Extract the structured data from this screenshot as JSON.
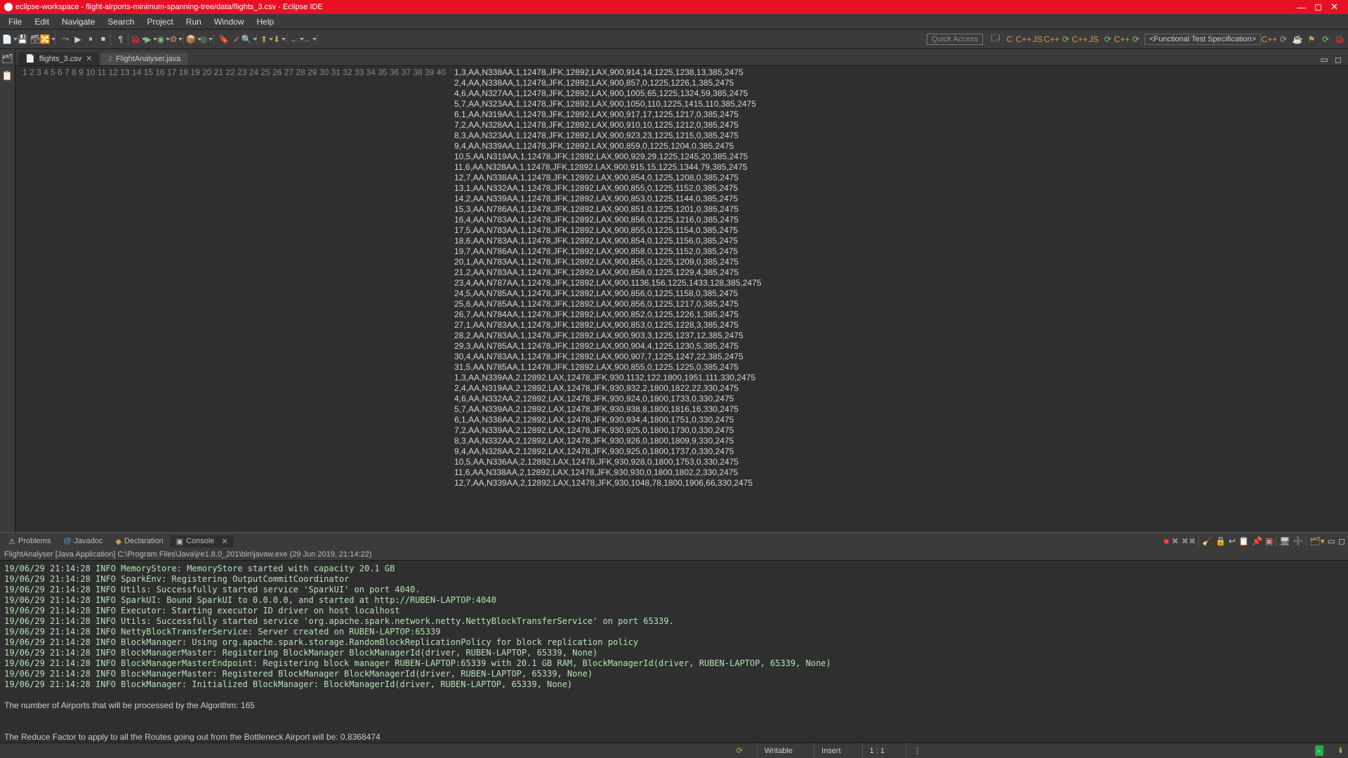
{
  "window_title": "eclipse-workspace - flight-airports-minimum-spanning-tree/data/flights_3.csv - Eclipse IDE",
  "menus": [
    "File",
    "Edit",
    "Navigate",
    "Search",
    "Project",
    "Run",
    "Window",
    "Help"
  ],
  "quick_access": "Quick Access",
  "perspective": "<Functional Test Specification>",
  "editor_tabs": [
    {
      "label": "flights_3.csv",
      "active": true
    },
    {
      "label": "FlightAnalyser.java",
      "active": false
    }
  ],
  "code_lines": [
    "1,3,AA,N338AA,1,12478,JFK,12892,LAX,900,914,14,1225,1238,13,385,2475",
    "2,4,AA,N338AA,1,12478,JFK,12892,LAX,900,857,0,1225,1226,1,385,2475",
    "4,6,AA,N327AA,1,12478,JFK,12892,LAX,900,1005,65,1225,1324,59,385,2475",
    "5,7,AA,N323AA,1,12478,JFK,12892,LAX,900,1050,110,1225,1415,110,385,2475",
    "6,1,AA,N319AA,1,12478,JFK,12892,LAX,900,917,17,1225,1217,0,385,2475",
    "7,2,AA,N328AA,1,12478,JFK,12892,LAX,900,910,10,1225,1212,0,385,2475",
    "8,3,AA,N323AA,1,12478,JFK,12892,LAX,900,923,23,1225,1215,0,385,2475",
    "9,4,AA,N339AA,1,12478,JFK,12892,LAX,900,859,0,1225,1204,0,385,2475",
    "10,5,AA,N319AA,1,12478,JFK,12892,LAX,900,929,29,1225,1245,20,385,2475",
    "11,6,AA,N328AA,1,12478,JFK,12892,LAX,900,915,15,1225,1344,79,385,2475",
    "12,7,AA,N338AA,1,12478,JFK,12892,LAX,900,854,0,1225,1208,0,385,2475",
    "13,1,AA,N332AA,1,12478,JFK,12892,LAX,900,855,0,1225,1152,0,385,2475",
    "14,2,AA,N339AA,1,12478,JFK,12892,LAX,900,853,0,1225,1144,0,385,2475",
    "15,3,AA,N786AA,1,12478,JFK,12892,LAX,900,851,0,1225,1201,0,385,2475",
    "16,4,AA,N783AA,1,12478,JFK,12892,LAX,900,856,0,1225,1216,0,385,2475",
    "17,5,AA,N783AA,1,12478,JFK,12892,LAX,900,855,0,1225,1154,0,385,2475",
    "18,6,AA,N783AA,1,12478,JFK,12892,LAX,900,854,0,1225,1156,0,385,2475",
    "19,7,AA,N786AA,1,12478,JFK,12892,LAX,900,858,0,1225,1152,0,385,2475",
    "20,1,AA,N783AA,1,12478,JFK,12892,LAX,900,855,0,1225,1209,0,385,2475",
    "21,2,AA,N783AA,1,12478,JFK,12892,LAX,900,858,0,1225,1229,4,385,2475",
    "23,4,AA,N787AA,1,12478,JFK,12892,LAX,900,1136,156,1225,1433,128,385,2475",
    "24,5,AA,N785AA,1,12478,JFK,12892,LAX,900,856,0,1225,1158,0,385,2475",
    "25,6,AA,N785AA,1,12478,JFK,12892,LAX,900,856,0,1225,1217,0,385,2475",
    "26,7,AA,N784AA,1,12478,JFK,12892,LAX,900,852,0,1225,1226,1,385,2475",
    "27,1,AA,N783AA,1,12478,JFK,12892,LAX,900,853,0,1225,1228,3,385,2475",
    "28,2,AA,N783AA,1,12478,JFK,12892,LAX,900,903,3,1225,1237,12,385,2475",
    "29,3,AA,N785AA,1,12478,JFK,12892,LAX,900,904,4,1225,1230,5,385,2475",
    "30,4,AA,N783AA,1,12478,JFK,12892,LAX,900,907,7,1225,1247,22,385,2475",
    "31,5,AA,N785AA,1,12478,JFK,12892,LAX,900,855,0,1225,1225,0,385,2475",
    "1,3,AA,N339AA,2,12892,LAX,12478,JFK,930,1132,122,1800,1951,111,330,2475",
    "2,4,AA,N319AA,2,12892,LAX,12478,JFK,930,932,2,1800,1822,22,330,2475",
    "4,6,AA,N332AA,2,12892,LAX,12478,JFK,930,924,0,1800,1733,0,330,2475",
    "5,7,AA,N339AA,2,12892,LAX,12478,JFK,930,938,8,1800,1816,16,330,2475",
    "6,1,AA,N338AA,2,12892,LAX,12478,JFK,930,934,4,1800,1751,0,330,2475",
    "7,2,AA,N339AA,2,12892,LAX,12478,JFK,930,925,0,1800,1730,0,330,2475",
    "8,3,AA,N332AA,2,12892,LAX,12478,JFK,930,926,0,1800,1809,9,330,2475",
    "9,4,AA,N328AA,2,12892,LAX,12478,JFK,930,925,0,1800,1737,0,330,2475",
    "10,5,AA,N336AA,2,12892,LAX,12478,JFK,930,928,0,1800,1753,0,330,2475",
    "11,6,AA,N338AA,2,12892,LAX,12478,JFK,930,930,0,1800,1802,2,330,2475",
    "12,7,AA,N339AA,2,12892,LAX,12478,JFK,930,1048,78,1800,1906,66,330,2475"
  ],
  "bottom_tabs": [
    {
      "label": "Problems",
      "active": false
    },
    {
      "label": "Javadoc",
      "active": false
    },
    {
      "label": "Declaration",
      "active": false
    },
    {
      "label": "Console",
      "active": true
    }
  ],
  "console_header": "FlightAnalyser [Java Application] C:\\Program Files\\Java\\jre1.8.0_201\\bin\\javaw.exe (29 Jun 2019, 21:14:22)",
  "console_lines": [
    "19/06/29 21:14:28 INFO MemoryStore: MemoryStore started with capacity 20.1 GB",
    "19/06/29 21:14:28 INFO SparkEnv: Registering OutputCommitCoordinator",
    "19/06/29 21:14:28 INFO Utils: Successfully started service 'SparkUI' on port 4040.",
    "19/06/29 21:14:28 INFO SparkUI: Bound SparkUI to 0.0.0.0, and started at http://RUBEN-LAPTOP:4040",
    "19/06/29 21:14:28 INFO Executor: Starting executor ID driver on host localhost",
    "19/06/29 21:14:28 INFO Utils: Successfully started service 'org.apache.spark.network.netty.NettyBlockTransferService' on port 65339.",
    "19/06/29 21:14:28 INFO NettyBlockTransferService: Server created on RUBEN-LAPTOP:65339",
    "19/06/29 21:14:28 INFO BlockManager: Using org.apache.spark.storage.RandomBlockReplicationPolicy for block replication policy",
    "19/06/29 21:14:28 INFO BlockManagerMaster: Registering BlockManager BlockManagerId(driver, RUBEN-LAPTOP, 65339, None)",
    "19/06/29 21:14:28 INFO BlockManagerMasterEndpoint: Registering block manager RUBEN-LAPTOP:65339 with 20.1 GB RAM, BlockManagerId(driver, RUBEN-LAPTOP, 65339, None)",
    "19/06/29 21:14:28 INFO BlockManagerMaster: Registered BlockManager BlockManagerId(driver, RUBEN-LAPTOP, 65339, None)",
    "19/06/29 21:14:28 INFO BlockManager: Initialized BlockManager: BlockManagerId(driver, RUBEN-LAPTOP, 65339, None)",
    "",
    "The number of Airports that will be processed by the Algorithm: 165",
    "",
    "",
    "The Reduce Factor to apply to all the Routes going out from the Bottleneck Airport will be: 0.8368474"
  ],
  "status": {
    "writable": "Writable",
    "insert": "Insert",
    "pos": "1 : 1"
  }
}
